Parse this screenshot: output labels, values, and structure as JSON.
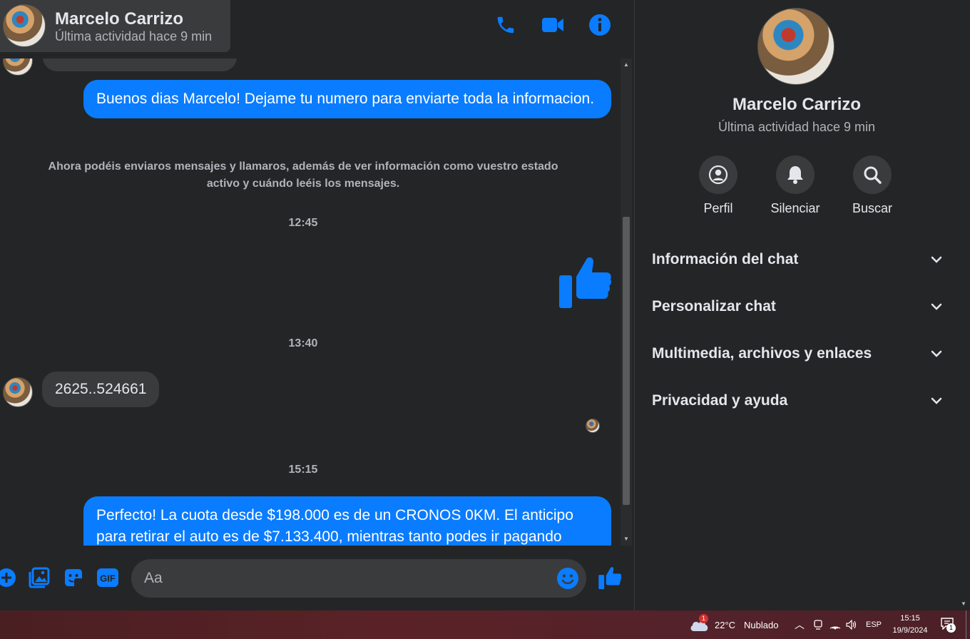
{
  "header": {
    "name": "Marcelo Carrizo",
    "status": "Última actividad hace 9 min"
  },
  "messages": {
    "partial_top_text": "...",
    "outgoing_1": "Buenos dias Marcelo! Dejame tu numero para enviarte toda la informacion.",
    "system_note": "Ahora podéis enviaros mensajes y llamaros, además de ver información como vuestro estado activo y cuándo leéis los mensajes.",
    "time_1": "12:45",
    "time_2": "13:40",
    "incoming_1": "2625..524661",
    "time_3": "15:15",
    "outgoing_2": "Perfecto! La cuota desde $198.000 es de un CRONOS 0KM. El anticipo para retirar el auto es de $7.133.400, mientras tanto podes ir pagando"
  },
  "composer": {
    "placeholder": "Aa"
  },
  "info": {
    "name": "Marcelo Carrizo",
    "status": "Última actividad hace 9 min",
    "actions": [
      {
        "label": "Perfil",
        "icon": "profile-icon"
      },
      {
        "label": "Silenciar",
        "icon": "bell-icon"
      },
      {
        "label": "Buscar",
        "icon": "search-icon"
      }
    ],
    "sections": [
      "Información del chat",
      "Personalizar chat",
      "Multimedia, archivos y enlaces",
      "Privacidad y ayuda"
    ]
  },
  "taskbar": {
    "weather_temp": "22°C",
    "weather_desc": "Nublado",
    "weather_badge": "1",
    "language": "ESP",
    "time": "15:15",
    "date": "19/9/2024",
    "notification_count": "1"
  },
  "colors": {
    "accent": "#0a7cff",
    "background": "#242526",
    "bubble_incoming": "#3a3b3c"
  }
}
